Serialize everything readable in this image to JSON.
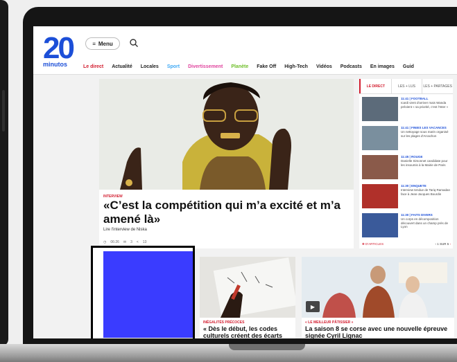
{
  "logo": {
    "number": "20",
    "word": "minutos"
  },
  "header": {
    "menu_label": "Menu"
  },
  "nav": [
    {
      "label": "Le direct",
      "color": "#d21c2e"
    },
    {
      "label": "Actualité",
      "color": "#222222"
    },
    {
      "label": "Locales",
      "color": "#222222"
    },
    {
      "label": "Sport",
      "color": "#3fa9f5"
    },
    {
      "label": "Divertissement",
      "color": "#e0449e"
    },
    {
      "label": "Planète",
      "color": "#6fbf2a"
    },
    {
      "label": "Fake Off",
      "color": "#222222"
    },
    {
      "label": "High-Tech",
      "color": "#222222"
    },
    {
      "label": "Vidéos",
      "color": "#222222"
    },
    {
      "label": "Podcasts",
      "color": "#222222"
    },
    {
      "label": "En images",
      "color": "#222222"
    },
    {
      "label": "Guid",
      "color": "#222222"
    }
  ],
  "hero": {
    "category": "INTERVIEW",
    "title": "«C’est la compétition qui m’a excité et m’a amené là»",
    "subtitle": "Lire l'interview de Niska",
    "meta": {
      "time": "06:26",
      "comments": "3",
      "shares": "13"
    }
  },
  "sidebar": {
    "tabs": [
      "LE DIRECT",
      "LES + LUS",
      "LES + PARTAGES"
    ],
    "items": [
      {
        "time": "11:41 | FOOTBALL",
        "text": "Icardi vient d'arriver mais Wanda prévient « sa priorité, c'est l'Inter »"
      },
      {
        "time": "11:41 | FINIES LES VACANCES",
        "text": "Un nettoyage sous marin organisé sur les plages d'Arcachon"
      },
      {
        "time": "11:45 | ROUGE",
        "text": "Danielle Simonnet candidate pour les insoumis à la Mairie de Paris"
      },
      {
        "time": "11:30 | ENQUETE",
        "text": "Interview tendue de Tariq Ramadan face à Jean-Jacques Bourdin"
      },
      {
        "time": "11:30 | FAITS DIVERS",
        "text": "Un corps en décomposition découvert dans un champ près de Lyon"
      }
    ],
    "footer": {
      "label": "D'ARTICLES",
      "pager": "1 SUR 5"
    }
  },
  "cards": [
    {
      "category": "INÉGALITÉS PRÉCOCES",
      "title": "« Dès le début, les codes culturels créent des écarts"
    },
    {
      "category": "« LE MEILLEUR PÂTISSIER »",
      "title": "La saison 8 se corse avec une nouvelle épreuve signée Cyril Lignac"
    }
  ],
  "colors": {
    "brand": "#1c4fd8",
    "accent": "#d21c2e",
    "placeholder": "#3a3cff"
  }
}
